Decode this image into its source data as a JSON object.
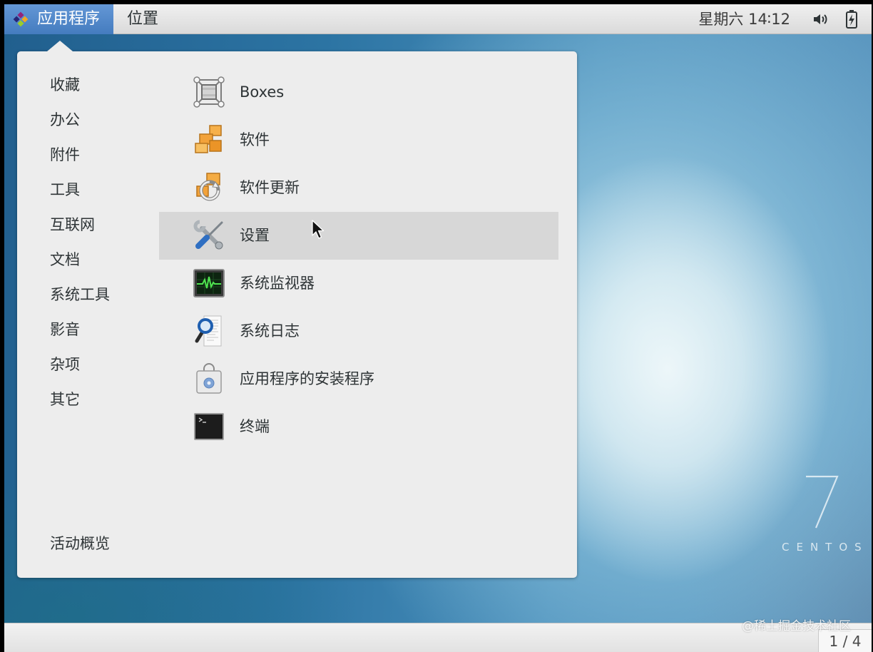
{
  "top_panel": {
    "applications_button": {
      "label": "应用程序",
      "icon": "centos-logo-icon"
    },
    "places_button": {
      "label": "位置"
    },
    "clock": "星期六 14∶12",
    "status_icons": [
      "volume-icon",
      "battery-charging-icon"
    ]
  },
  "app_menu": {
    "categories": [
      {
        "label": "收藏"
      },
      {
        "label": "办公"
      },
      {
        "label": "附件"
      },
      {
        "label": "工具"
      },
      {
        "label": "互联网"
      },
      {
        "label": "文档"
      },
      {
        "label": "系统工具"
      },
      {
        "label": "影音"
      },
      {
        "label": "杂项"
      },
      {
        "label": "其它"
      }
    ],
    "activities_overview": "活动概览",
    "apps": [
      {
        "label": "Boxes",
        "icon": "boxes-icon",
        "highlighted": false
      },
      {
        "label": "软件",
        "icon": "software-icon",
        "highlighted": false
      },
      {
        "label": "软件更新",
        "icon": "software-update-icon",
        "highlighted": false
      },
      {
        "label": "设置",
        "icon": "settings-icon",
        "highlighted": true
      },
      {
        "label": "系统监视器",
        "icon": "system-monitor-icon",
        "highlighted": false
      },
      {
        "label": "系统日志",
        "icon": "system-log-icon",
        "highlighted": false
      },
      {
        "label": "应用程序的安装程序",
        "icon": "app-installer-icon",
        "highlighted": false
      },
      {
        "label": "终端",
        "icon": "terminal-icon",
        "highlighted": false
      }
    ]
  },
  "desktop": {
    "logo_number": "7",
    "logo_text": "CENTOS"
  },
  "bottom_panel": {
    "workspace_indicator": "1 / 4"
  },
  "watermark": "@稀土掘金技术社区",
  "cursor_icon": "arrow-pointer-icon",
  "colors": {
    "accent": "#4a86cf",
    "menu_background": "#ededed",
    "highlight_row": "#d7d7d7",
    "panel": "#e4e4e4",
    "text": "#2e3436"
  }
}
